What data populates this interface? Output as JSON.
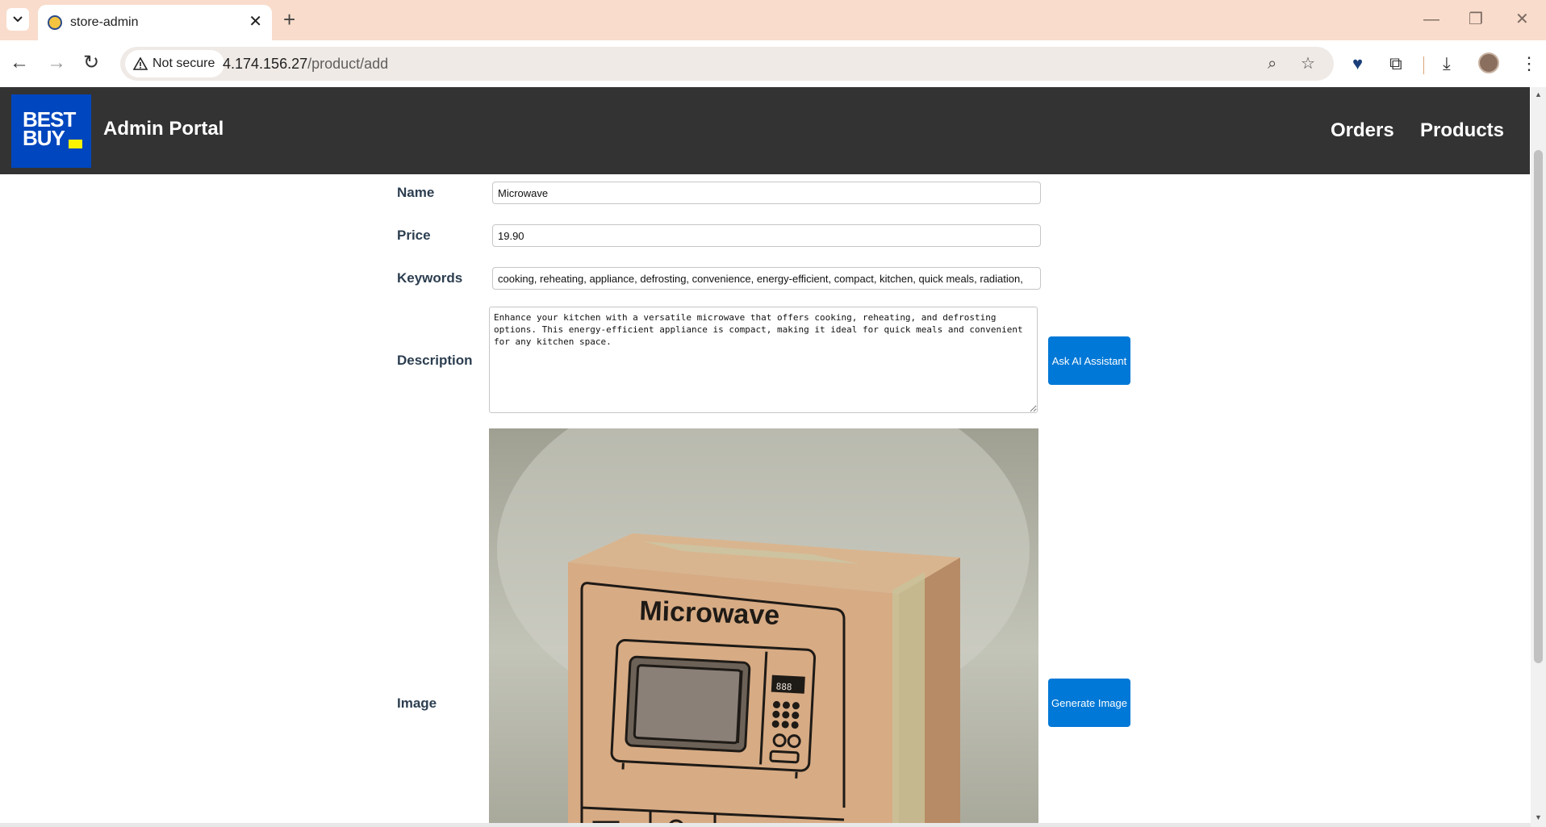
{
  "browser": {
    "tab_title": "store-admin",
    "new_tab_symbol": "+",
    "security_label": "Not secure",
    "url_host": "4.174.156.27",
    "url_path": "/product/add"
  },
  "header": {
    "logo_text_line1": "BEST",
    "logo_text_line2": "BUY",
    "title": "Admin Portal",
    "nav": [
      {
        "label": "Orders"
      },
      {
        "label": "Products"
      }
    ]
  },
  "form": {
    "name": {
      "label": "Name",
      "value": "Microwave"
    },
    "price": {
      "label": "Price",
      "value": "19.90"
    },
    "keywords": {
      "label": "Keywords",
      "value": "cooking, reheating, appliance, defrosting, convenience, energy-efficient, compact, kitchen, quick meals, radiation,"
    },
    "description": {
      "label": "Description",
      "value": "Enhance your kitchen with a versatile microwave that offers cooking, reheating, and defrosting options. This energy-efficient appliance is compact, making it ideal for quick meals and convenient for any kitchen space."
    },
    "ask_ai_button": "Ask AI Assistant",
    "image": {
      "label": "Image",
      "box_text": "Microwave",
      "display_text": "888"
    },
    "generate_image_button": "Generate Image"
  },
  "colors": {
    "tabbar_bg": "#f9dccb",
    "header_bg": "#333333",
    "logo_bg": "#0046be",
    "logo_tag": "#fff200",
    "button_bg": "#0078d7"
  },
  "icons": [
    "tab-list-icon",
    "favicon-icon",
    "close-icon",
    "back-arrow-icon",
    "forward-arrow-icon",
    "reload-icon",
    "warning-icon",
    "zoom-icon",
    "star-icon",
    "extension-heart-icon",
    "puzzle-icon",
    "download-icon",
    "menu-dots-icon",
    "minimize-icon",
    "restore-icon",
    "window-close-icon"
  ]
}
